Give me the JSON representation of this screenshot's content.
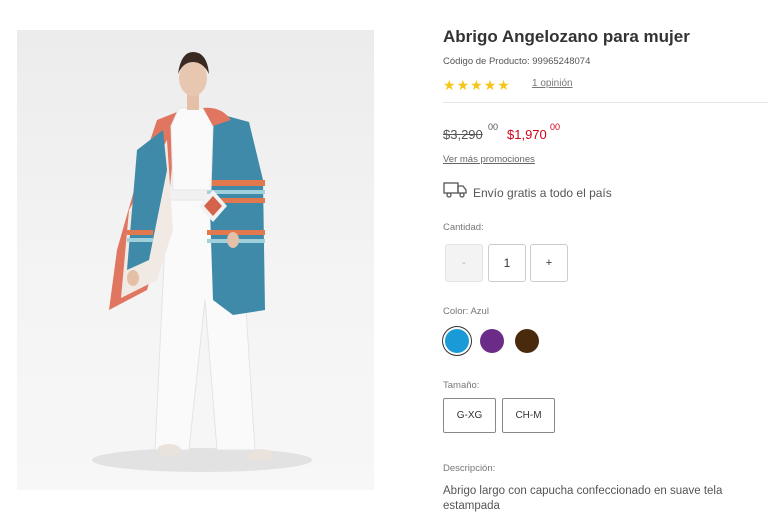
{
  "product": {
    "title": "Abrigo Angelozano para mujer",
    "sku_text": "Código de Producto: 99965248074",
    "rating_stars": 5,
    "reviews_link": "1 opinión",
    "image_alt": "product-photo"
  },
  "price": {
    "old_main": "$3,290",
    "old_cents": "00",
    "new_main": "$1,970",
    "new_cents": "00",
    "promos_link": "Ver más promociones"
  },
  "shipping": {
    "icon": "truck-icon",
    "text": "Envío gratis a todo el país"
  },
  "quantity": {
    "label": "Cantidad:",
    "minus": "-",
    "value": "1",
    "plus": "+"
  },
  "color": {
    "label": "Color: Azul",
    "swatches": [
      {
        "name": "Azul",
        "hex": "#1a9bd7",
        "selected": true
      },
      {
        "name": "Morado",
        "hex": "#6a2c87",
        "selected": false
      },
      {
        "name": "Café",
        "hex": "#4a2a0c",
        "selected": false
      }
    ]
  },
  "size": {
    "label": "Tamaño:",
    "options": [
      "G-XG",
      "CH-M"
    ]
  },
  "description": {
    "label": "Descripción:",
    "text": "Abrigo largo con capucha confeccionado en suave tela estampada"
  },
  "colors": {
    "sale_price": "#d0021b",
    "star": "#f5c518"
  }
}
